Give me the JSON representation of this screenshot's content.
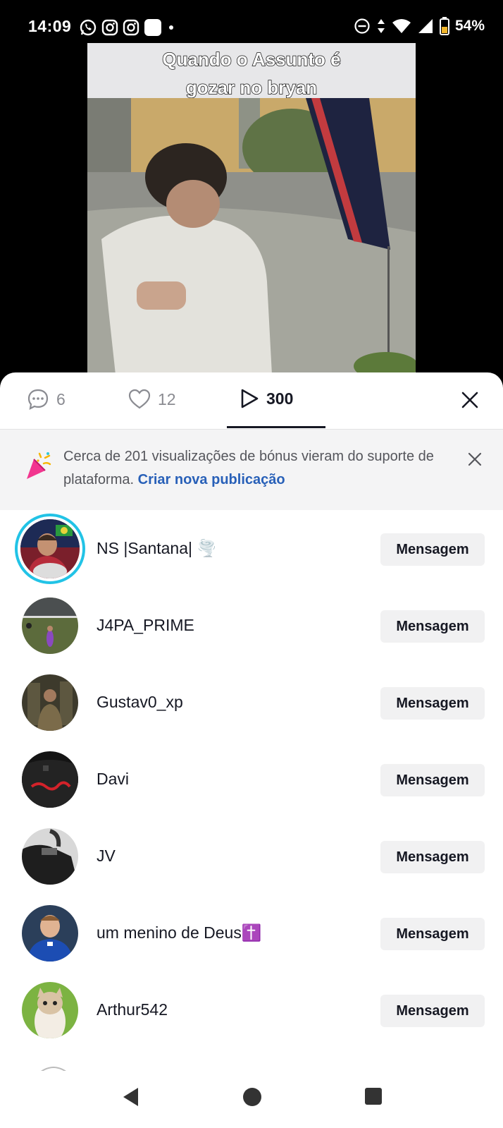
{
  "status_bar": {
    "time": "14:09",
    "battery": "54%",
    "left_icons": [
      "whatsapp-icon",
      "instagram-icon",
      "instagram-icon",
      "app-icon",
      "dot-icon"
    ],
    "right_icons": [
      "dnd-icon",
      "data-arrows-icon",
      "wifi-icon",
      "signal-icon",
      "battery-icon"
    ]
  },
  "video": {
    "caption_line1": "Quando o Assunto é",
    "caption_line2": "gozar no bryan"
  },
  "tabs": {
    "comments_count": "6",
    "likes_count": "12",
    "views_count": "300",
    "active": "views"
  },
  "banner": {
    "text": "Cerca de 201 visualizações de bónus vieram do suporte de plataforma.",
    "link": "Criar nova publicação"
  },
  "viewers": [
    {
      "name": "NS |Santana| 🌪️",
      "button": "Mensagem",
      "story_ring": true
    },
    {
      "name": "J4PA_PRIME",
      "button": "Mensagem"
    },
    {
      "name": "Gustav0_xp",
      "button": "Mensagem"
    },
    {
      "name": "Davi",
      "button": "Mensagem"
    },
    {
      "name": "JV",
      "button": "Mensagem"
    },
    {
      "name": "um menino de Deus✝️",
      "button": "Mensagem"
    },
    {
      "name": "Arthur542",
      "button": "Mensagem"
    }
  ],
  "colors": {
    "story_ring": "#22c3e6",
    "link": "#2860b8",
    "banner_bg": "#f4f4f5"
  }
}
